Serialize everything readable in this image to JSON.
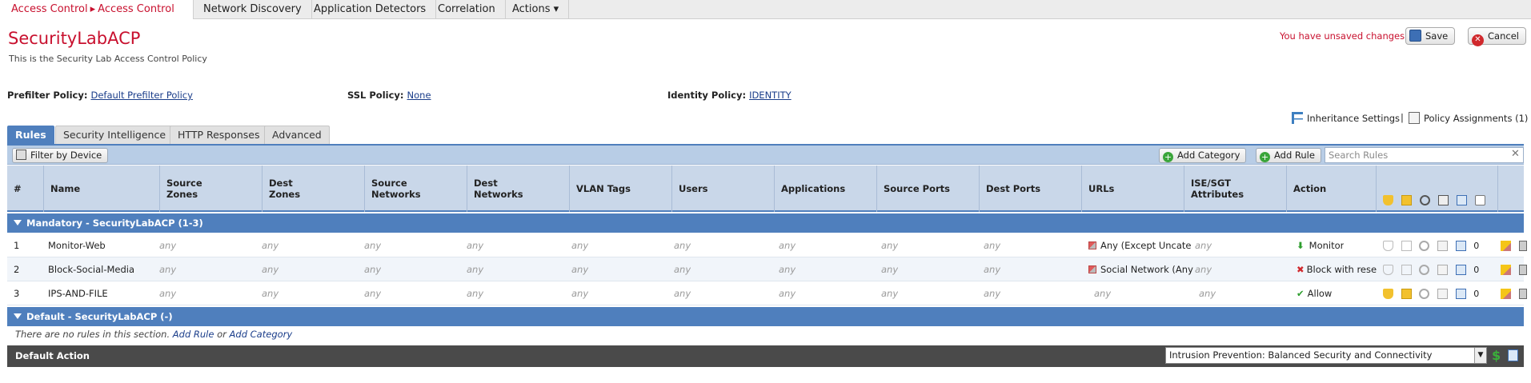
{
  "topnav": {
    "active_part1": "Access Control",
    "active_sep": "▸",
    "active_part2": "Access Control",
    "tabs": [
      "Network Discovery",
      "Application Detectors",
      "Correlation",
      "Actions ▾"
    ]
  },
  "policy": {
    "name": "SecurityLabACP",
    "description": "This is the Security Lab Access Control Policy"
  },
  "status": {
    "unsaved": "You have unsaved changes"
  },
  "buttons": {
    "save": "Save",
    "cancel": "Cancel"
  },
  "policies": {
    "prefilter_label": "Prefilter Policy:",
    "prefilter_value": "Default Prefilter Policy",
    "ssl_label": "SSL Policy:",
    "ssl_value": "None",
    "identity_label": "Identity Policy:",
    "identity_value": "IDENTITY"
  },
  "inheritance": {
    "settings": "Inheritance Settings",
    "sep": "|",
    "assignments": "Policy Assignments (1)"
  },
  "subtabs": [
    "Rules",
    "Security Intelligence",
    "HTTP Responses",
    "Advanced"
  ],
  "toolbar": {
    "filter": "Filter by Device",
    "add_category": "Add Category",
    "add_rule": "Add Rule",
    "search_placeholder": "Search Rules"
  },
  "columns": [
    "#",
    "Name",
    "Source Zones",
    "Dest Zones",
    "Source Networks",
    "Dest Networks",
    "VLAN Tags",
    "Users",
    "Applications",
    "Source Ports",
    "Dest Ports",
    "URLs",
    "ISE/SGT Attributes",
    "Action"
  ],
  "categories": {
    "mandatory": "Mandatory - SecurityLabACP (1-3)",
    "default": "Default - SecurityLabACP (-)"
  },
  "rules": [
    {
      "num": "1",
      "name": "Monitor-Web",
      "src_zones": "any",
      "dst_zones": "any",
      "src_nets": "any",
      "dst_nets": "any",
      "vlan": "any",
      "users": "any",
      "apps": "any",
      "src_ports": "any",
      "dst_ports": "any",
      "urls": "Any (Except Uncate",
      "ise": "any",
      "action": "Monitor",
      "count": "0"
    },
    {
      "num": "2",
      "name": "Block-Social-Media",
      "src_zones": "any",
      "dst_zones": "any",
      "src_nets": "any",
      "dst_nets": "any",
      "vlan": "any",
      "users": "any",
      "apps": "any",
      "src_ports": "any",
      "dst_ports": "any",
      "urls": "Social Network (Any",
      "ise": "any",
      "action": "Block with reset",
      "count": "0"
    },
    {
      "num": "3",
      "name": "IPS-AND-FILE",
      "src_zones": "any",
      "dst_zones": "any",
      "src_nets": "any",
      "dst_nets": "any",
      "vlan": "any",
      "users": "any",
      "apps": "any",
      "src_ports": "any",
      "dst_ports": "any",
      "urls": "any",
      "ise": "any",
      "action": "Allow",
      "count": "0"
    }
  ],
  "norules": {
    "text": "There are no rules in this section.",
    "add_rule": "Add Rule",
    "or": "or",
    "add_category": "Add Category"
  },
  "default_action": {
    "label": "Default Action",
    "value": "Intrusion Prevention: Balanced Security and Connectivity",
    "dollar": "$"
  },
  "colors": {
    "brand_red": "#c8102e",
    "header_blue": "#4f7fbd",
    "toolbar_blue": "#b8cde6",
    "allow_green": "#2e9e2e"
  }
}
